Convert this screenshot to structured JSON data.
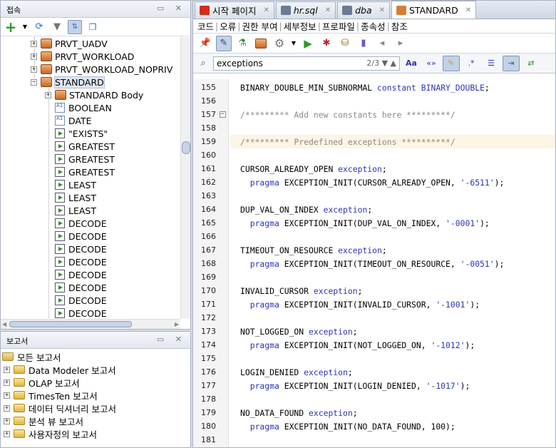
{
  "connections": {
    "title": "접속",
    "nodes": [
      {
        "label": "PRVT_UADV",
        "type": "package",
        "indent": 1,
        "expander": "+"
      },
      {
        "label": "PRVT_WORKLOAD",
        "type": "package",
        "indent": 1,
        "expander": "+"
      },
      {
        "label": "PRVT_WORKLOAD_NOPRIV",
        "type": "package",
        "indent": 1,
        "expander": "+"
      },
      {
        "label": "STANDARD",
        "type": "package",
        "indent": 1,
        "expander": "-",
        "selected": true
      },
      {
        "label": "STANDARD Body",
        "type": "package",
        "indent": 2,
        "expander": "+"
      },
      {
        "label": "BOOLEAN",
        "type": "type",
        "indent": 2
      },
      {
        "label": "DATE",
        "type": "type",
        "indent": 2
      },
      {
        "label": "\"EXISTS\"",
        "type": "function",
        "indent": 2
      },
      {
        "label": "GREATEST",
        "type": "function",
        "indent": 2
      },
      {
        "label": "GREATEST",
        "type": "function",
        "indent": 2
      },
      {
        "label": "GREATEST",
        "type": "function",
        "indent": 2
      },
      {
        "label": "LEAST",
        "type": "function",
        "indent": 2
      },
      {
        "label": "LEAST",
        "type": "function",
        "indent": 2
      },
      {
        "label": "LEAST",
        "type": "function",
        "indent": 2
      },
      {
        "label": "DECODE",
        "type": "function",
        "indent": 2
      },
      {
        "label": "DECODE",
        "type": "function",
        "indent": 2
      },
      {
        "label": "DECODE",
        "type": "function",
        "indent": 2
      },
      {
        "label": "DECODE",
        "type": "function",
        "indent": 2
      },
      {
        "label": "DECODE",
        "type": "function",
        "indent": 2
      },
      {
        "label": "DECODE",
        "type": "function",
        "indent": 2
      },
      {
        "label": "DECODE",
        "type": "function",
        "indent": 2
      },
      {
        "label": "DECODE",
        "type": "function",
        "indent": 2
      }
    ]
  },
  "reports": {
    "title": "보고서",
    "items": [
      {
        "label": "모든 보고서",
        "root": true
      },
      {
        "label": "Data Modeler 보고서"
      },
      {
        "label": "OLAP 보고서"
      },
      {
        "label": "TimesTen 보고서"
      },
      {
        "label": "데이터 딕셔너리 보고서"
      },
      {
        "label": "분석 뷰 보고서"
      },
      {
        "label": "사용자정의 보고서"
      }
    ]
  },
  "editor": {
    "tabs": [
      {
        "label": "시작 페이지",
        "icon": "oracle-icon",
        "color": "#d42b1e",
        "italic": false,
        "active": false
      },
      {
        "label": "hr.sql",
        "icon": "sql-file-icon",
        "color": "#6c7a93",
        "italic": true,
        "active": false
      },
      {
        "label": "dba",
        "icon": "sql-file-icon",
        "color": "#6c7a93",
        "italic": true,
        "active": false
      },
      {
        "label": "STANDARD",
        "icon": "package-icon",
        "color": "#d97b35",
        "italic": false,
        "active": true
      }
    ],
    "subtabs": [
      "코드",
      "오류",
      "권한 부여",
      "세부정보",
      "프로파일",
      "종속성",
      "참조"
    ],
    "find": {
      "query": "exceptions",
      "count": "2/3"
    }
  },
  "code_lines": [
    {
      "n": "155",
      "parts": [
        [
          "t",
          "BINARY_DOUBLE_MIN_SUBNORMAL "
        ],
        [
          "k",
          "constant"
        ],
        [
          "t",
          " "
        ],
        [
          "k",
          "BINARY_DOUBLE"
        ],
        [
          "t",
          ";"
        ]
      ]
    },
    {
      "n": "156",
      "parts": []
    },
    {
      "n": "157",
      "fold": true,
      "parts": [
        [
          "c",
          "/********* Add new constants here *********/"
        ]
      ]
    },
    {
      "n": "158",
      "parts": []
    },
    {
      "n": "159",
      "current": true,
      "parts": [
        [
          "c",
          "/********* Predefined exceptions **********/"
        ]
      ]
    },
    {
      "n": "160",
      "parts": []
    },
    {
      "n": "161",
      "parts": [
        [
          "t",
          "CURSOR_ALREADY_OPEN "
        ],
        [
          "k",
          "exception"
        ],
        [
          "t",
          ";"
        ]
      ]
    },
    {
      "n": "162",
      "parts": [
        [
          "t",
          "  "
        ],
        [
          "k",
          "pragma"
        ],
        [
          "t",
          " EXCEPTION_INIT(CURSOR_ALREADY_OPEN, "
        ],
        [
          "s",
          "'-6511'"
        ],
        [
          "t",
          ");"
        ]
      ]
    },
    {
      "n": "163",
      "parts": []
    },
    {
      "n": "164",
      "parts": [
        [
          "t",
          "DUP_VAL_ON_INDEX "
        ],
        [
          "k",
          "exception"
        ],
        [
          "t",
          ";"
        ]
      ]
    },
    {
      "n": "165",
      "parts": [
        [
          "t",
          "  "
        ],
        [
          "k",
          "pragma"
        ],
        [
          "t",
          " EXCEPTION_INIT(DUP_VAL_ON_INDEX, "
        ],
        [
          "s",
          "'-0001'"
        ],
        [
          "t",
          ");"
        ]
      ]
    },
    {
      "n": "166",
      "parts": []
    },
    {
      "n": "167",
      "parts": [
        [
          "t",
          "TIMEOUT_ON_RESOURCE "
        ],
        [
          "k",
          "exception"
        ],
        [
          "t",
          ";"
        ]
      ]
    },
    {
      "n": "168",
      "parts": [
        [
          "t",
          "  "
        ],
        [
          "k",
          "pragma"
        ],
        [
          "t",
          " EXCEPTION_INIT(TIMEOUT_ON_RESOURCE, "
        ],
        [
          "s",
          "'-0051'"
        ],
        [
          "t",
          ");"
        ]
      ]
    },
    {
      "n": "169",
      "parts": []
    },
    {
      "n": "170",
      "parts": [
        [
          "t",
          "INVALID_CURSOR "
        ],
        [
          "k",
          "exception"
        ],
        [
          "t",
          ";"
        ]
      ]
    },
    {
      "n": "171",
      "parts": [
        [
          "t",
          "  "
        ],
        [
          "k",
          "pragma"
        ],
        [
          "t",
          " EXCEPTION_INIT(INVALID_CURSOR, "
        ],
        [
          "s",
          "'-1001'"
        ],
        [
          "t",
          ");"
        ]
      ]
    },
    {
      "n": "172",
      "parts": []
    },
    {
      "n": "173",
      "parts": [
        [
          "t",
          "NOT_LOGGED_ON "
        ],
        [
          "k",
          "exception"
        ],
        [
          "t",
          ";"
        ]
      ]
    },
    {
      "n": "174",
      "parts": [
        [
          "t",
          "  "
        ],
        [
          "k",
          "pragma"
        ],
        [
          "t",
          " EXCEPTION_INIT(NOT_LOGGED_ON, "
        ],
        [
          "s",
          "'-1012'"
        ],
        [
          "t",
          ");"
        ]
      ]
    },
    {
      "n": "175",
      "parts": []
    },
    {
      "n": "176",
      "parts": [
        [
          "t",
          "LOGIN_DENIED "
        ],
        [
          "k",
          "exception"
        ],
        [
          "t",
          ";"
        ]
      ]
    },
    {
      "n": "177",
      "parts": [
        [
          "t",
          "  "
        ],
        [
          "k",
          "pragma"
        ],
        [
          "t",
          " EXCEPTION_INIT(LOGIN_DENIED, "
        ],
        [
          "s",
          "'-1017'"
        ],
        [
          "t",
          ");"
        ]
      ]
    },
    {
      "n": "178",
      "parts": []
    },
    {
      "n": "179",
      "parts": [
        [
          "t",
          "NO_DATA_FOUND "
        ],
        [
          "k",
          "exception"
        ],
        [
          "t",
          ";"
        ]
      ]
    },
    {
      "n": "180",
      "parts": [
        [
          "t",
          "  "
        ],
        [
          "k",
          "pragma"
        ],
        [
          "t",
          " EXCEPTION_INIT(NO_DATA_FOUND, 100);"
        ]
      ]
    },
    {
      "n": "181",
      "parts": []
    }
  ]
}
